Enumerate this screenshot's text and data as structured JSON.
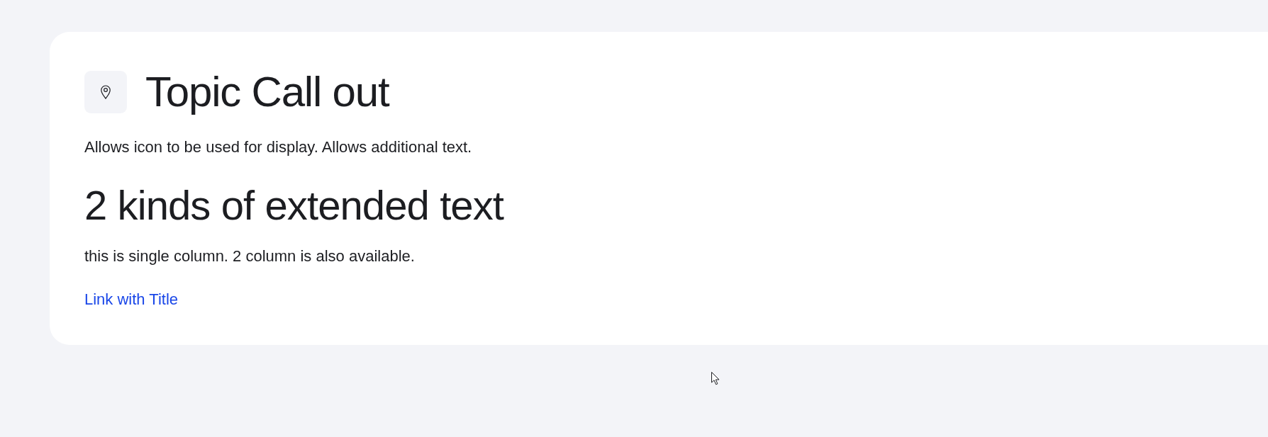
{
  "card": {
    "title": "Topic Call out",
    "description": "Allows icon to be used for display. Allows additional text.",
    "heading": "2 kinds of extended text",
    "body": "this is single column. 2 column is also available.",
    "link": "Link with Title"
  }
}
